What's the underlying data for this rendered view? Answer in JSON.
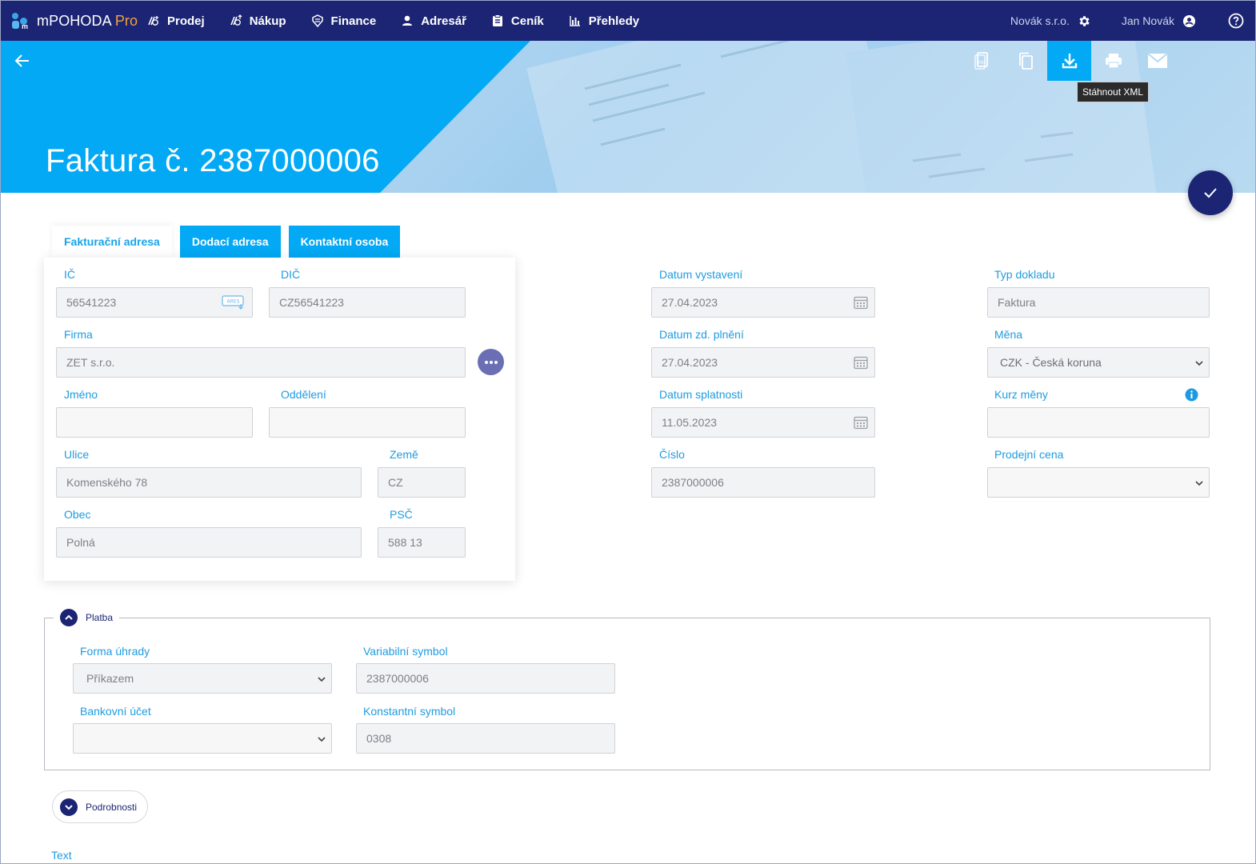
{
  "app": {
    "name": "mPOHODA",
    "edition": "Pro"
  },
  "nav": {
    "items": [
      {
        "label": "Prodej",
        "icon": "sales-icon"
      },
      {
        "label": "Nákup",
        "icon": "purchase-icon"
      },
      {
        "label": "Finance",
        "icon": "finance-icon"
      },
      {
        "label": "Adresář",
        "icon": "person-icon"
      },
      {
        "label": "Ceník",
        "icon": "clipboard-icon"
      },
      {
        "label": "Přehledy",
        "icon": "bar-chart-icon"
      }
    ],
    "company": "Novák s.r.o.",
    "user": "Jan Novák"
  },
  "header": {
    "title": "Faktura č. 2387000006",
    "toolbar": [
      "pdf-icon",
      "copy-icon",
      "download-icon",
      "print-icon",
      "email-icon"
    ],
    "tooltip": "Stáhnout XML",
    "accent": "#03a9f4",
    "brand": "#1c2573"
  },
  "tabs": [
    "Fakturační adresa",
    "Dodací adresa",
    "Kontaktní osoba"
  ],
  "address": {
    "ic_label": "IČ",
    "ic": "56541223",
    "dic_label": "DIČ",
    "dic": "CZ56541223",
    "firma_label": "Firma",
    "firma": "ZET s.r.o.",
    "jmeno_label": "Jméno",
    "jmeno": "",
    "oddeleni_label": "Oddělení",
    "oddeleni": "",
    "ulice_label": "Ulice",
    "ulice": "Komenského 78",
    "zeme_label": "Země",
    "zeme": "CZ",
    "obec_label": "Obec",
    "obec": "Polná",
    "psc_label": "PSČ",
    "psc": "588 13",
    "ares_badge": "ARES"
  },
  "dates": {
    "vystaveni_label": "Datum vystavení",
    "vystaveni": "27.04.2023",
    "plneni_label": "Datum zd. plnění",
    "plneni": "27.04.2023",
    "splatnosti_label": "Datum splatnosti",
    "splatnosti": "11.05.2023",
    "cislo_label": "Číslo",
    "cislo": "2387000006"
  },
  "doc": {
    "typ_label": "Typ dokladu",
    "typ": "Faktura",
    "mena_label": "Měna",
    "mena": "CZK - Česká koruna",
    "kurz_label": "Kurz měny",
    "kurz": "",
    "cena_label": "Prodejní cena",
    "cena": ""
  },
  "platba": {
    "legend": "Platba",
    "forma_label": "Forma úhrady",
    "forma": "Příkazem",
    "ucet_label": "Bankovní účet",
    "ucet": "",
    "vs_label": "Variabilní symbol",
    "vs": "2387000006",
    "ks_label": "Konstantní symbol",
    "ks": "0308"
  },
  "podrobnosti": "Podrobnosti",
  "text_label": "Text"
}
